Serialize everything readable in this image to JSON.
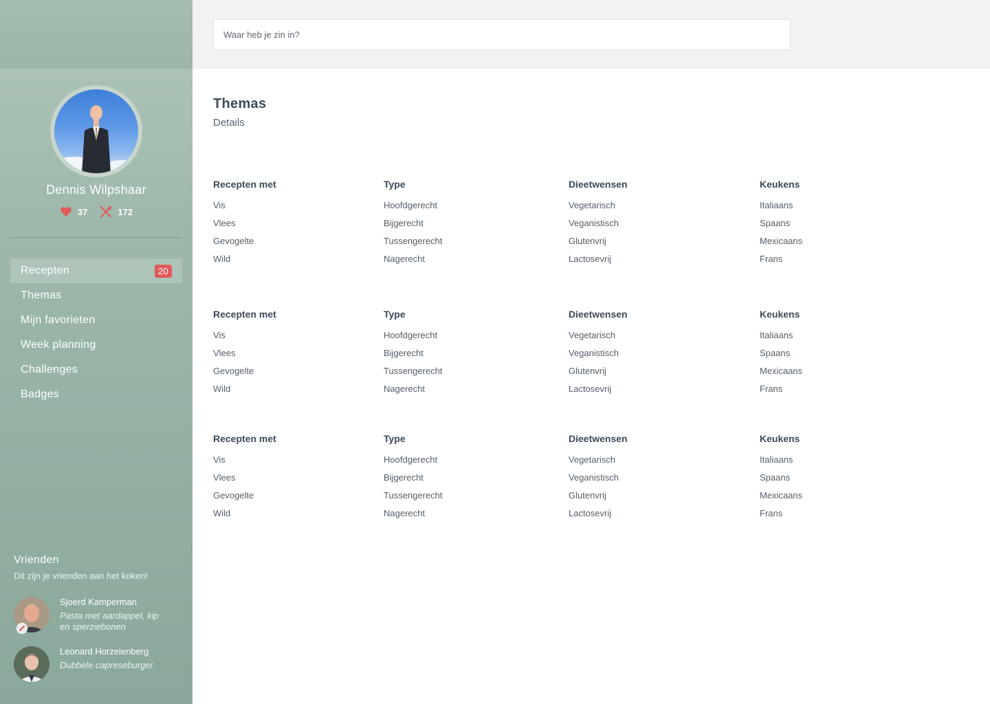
{
  "search": {
    "placeholder": "Waar heb je zin in?"
  },
  "user": {
    "name": "Dennis Wilpshaar",
    "likes": "37",
    "recipes": "172"
  },
  "nav": [
    {
      "label": "Recepten",
      "badge": "20",
      "active": true
    },
    {
      "label": "Themas"
    },
    {
      "label": "Mijn favorieten"
    },
    {
      "label": "Week planning"
    },
    {
      "label": "Challenges"
    },
    {
      "label": "Badges"
    }
  ],
  "friends": {
    "title": "Vrienden",
    "subtitle": "Dit zijn je vrienden aan het koken!",
    "list": [
      {
        "name": "Sjoerd Kamperman",
        "recipe": "Pasta met aardappel, kip en sperziebonen"
      },
      {
        "name": "Leonard Horzelenberg",
        "recipe": "Dubbele capreseburger"
      }
    ]
  },
  "page": {
    "title": "Themas",
    "subtitle": "Details"
  },
  "groups": [
    {
      "columns": [
        {
          "heading": "Recepten met",
          "items": [
            "Vis",
            "Vlees",
            "Gevogelte",
            "Wild"
          ]
        },
        {
          "heading": "Type",
          "items": [
            "Hoofdgerecht",
            "Bijgerecht",
            "Tussengerecht",
            "Nagerecht"
          ]
        },
        {
          "heading": "Dieetwensen",
          "items": [
            "Vegetarisch",
            "Veganistisch",
            "Glutenvrij",
            "Lactosevrij"
          ]
        },
        {
          "heading": "Keukens",
          "items": [
            "Italiaans",
            "Spaans",
            "Mexicaans",
            "Frans"
          ]
        }
      ]
    },
    {
      "columns": [
        {
          "heading": "Recepten met",
          "items": [
            "Vis",
            "Vlees",
            "Gevogelte",
            "Wild"
          ]
        },
        {
          "heading": "Type",
          "items": [
            "Hoofdgerecht",
            "Bijgerecht",
            "Tussengerecht",
            "Nagerecht"
          ]
        },
        {
          "heading": "Dieetwensen",
          "items": [
            "Vegetarisch",
            "Veganistisch",
            "Glutenvrij",
            "Lactosevrij"
          ]
        },
        {
          "heading": "Keukens",
          "items": [
            "Italiaans",
            "Spaans",
            "Mexicaans",
            "Frans"
          ]
        }
      ]
    },
    {
      "columns": [
        {
          "heading": "Recepten met",
          "items": [
            "Vis",
            "Vlees",
            "Gevogelte",
            "Wild"
          ]
        },
        {
          "heading": "Type",
          "items": [
            "Hoofdgerecht",
            "Bijgerecht",
            "Tussengerecht",
            "Nagerecht"
          ]
        },
        {
          "heading": "Dieetwensen",
          "items": [
            "Vegetarisch",
            "Veganistisch",
            "Glutenvrij",
            "Lactosevrij"
          ]
        },
        {
          "heading": "Keukens",
          "items": [
            "Italiaans",
            "Spaans",
            "Mexicaans",
            "Frans"
          ]
        }
      ]
    }
  ],
  "colors": {
    "sidebar": "#9fb9ac",
    "badge": "#e05a5a",
    "heart": "#e05a5a",
    "text": "#3e4e5e"
  },
  "icons": {
    "likes": "heart-icon",
    "recipes": "cutlery-icon",
    "cooking": "pencil-icon"
  }
}
